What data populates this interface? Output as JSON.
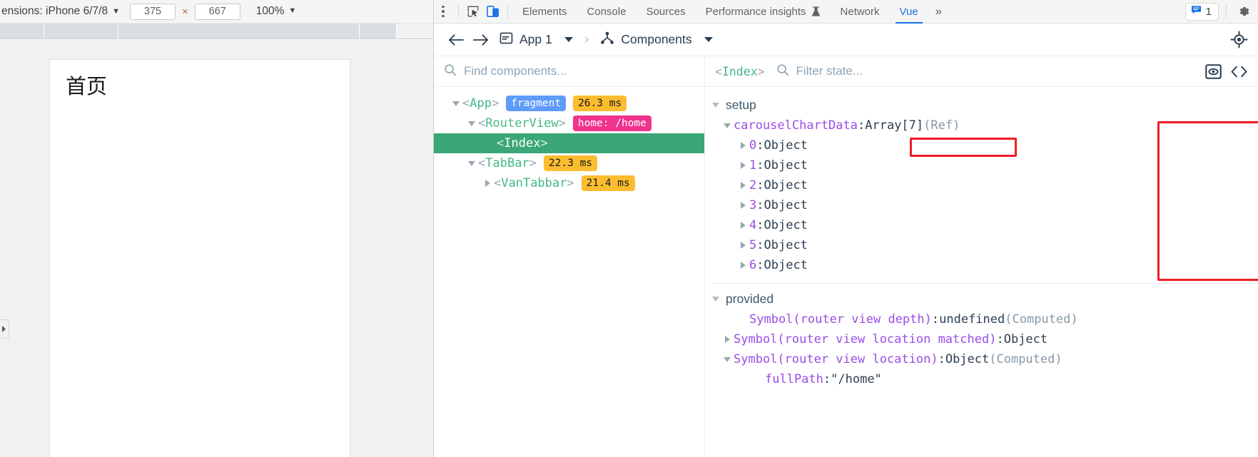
{
  "device_toolbar": {
    "dimensions_label": "ensions: iPhone 6/7/8",
    "width_value": "375",
    "x_symbol": "×",
    "height_value": "667",
    "zoom_value": "100%",
    "caret": "▼",
    "menu_icon": "kebab-menu-icon"
  },
  "viewport": {
    "page_heading": "首页"
  },
  "devtools": {
    "icons": {
      "inspect": "inspect-element-icon",
      "device": "device-toolbar-icon",
      "more_tabs": "»",
      "settings": "gear-icon",
      "issues": "issues-message-icon"
    },
    "tabs": [
      {
        "label": "Elements",
        "active": false
      },
      {
        "label": "Console",
        "active": false
      },
      {
        "label": "Sources",
        "active": false
      },
      {
        "label": "Performance insights",
        "active": false,
        "suffix_icon": "flask-icon"
      },
      {
        "label": "Network",
        "active": false
      },
      {
        "label": "Vue",
        "active": true
      }
    ],
    "issues_count": "1"
  },
  "vue_devtools": {
    "header": {
      "back_icon": "arrow-left-icon",
      "forward_icon": "arrow-right-icon",
      "app_icon": "app-window-icon",
      "app_label": "App 1",
      "breadcrumb_sep": "›",
      "view_icon": "component-tree-icon",
      "view_label": "Components",
      "target_icon": "select-component-target-icon"
    },
    "tree_panel": {
      "search_placeholder": "Find components...",
      "search_value": "",
      "search_icon": "search-icon",
      "nodes": [
        {
          "indent": 0,
          "twisty": "down",
          "open_br": "<",
          "name": "App",
          "close_br": ">",
          "badges": [
            {
              "text": "fragment",
              "kind": "fragment"
            },
            {
              "text": "26.3 ms",
              "kind": "time"
            }
          ],
          "selected": false
        },
        {
          "indent": 1,
          "twisty": "down",
          "open_br": "<",
          "name": "RouterView",
          "close_br": ">",
          "badges": [
            {
              "text": "home: /home",
              "kind": "route"
            }
          ],
          "selected": false
        },
        {
          "indent": 2,
          "twisty": "none",
          "open_br": "<",
          "name": "Index",
          "close_br": ">",
          "badges": [],
          "selected": true
        },
        {
          "indent": 1,
          "twisty": "down",
          "open_br": "<",
          "name": "TabBar",
          "close_br": ">",
          "badges": [
            {
              "text": "22.3 ms",
              "kind": "time"
            }
          ],
          "selected": false
        },
        {
          "indent": 2,
          "twisty": "right",
          "open_br": "<",
          "name": "VanTabbar",
          "close_br": ">",
          "badges": [
            {
              "text": "21.4 ms",
              "kind": "time"
            }
          ],
          "selected": false
        }
      ]
    },
    "state_panel": {
      "selected_component": {
        "open_br": "<",
        "name": "Index",
        "close_br": ">"
      },
      "filter_placeholder": "Filter state...",
      "filter_value": "",
      "search_icon": "search-icon",
      "eye_icon": "eye-inspect-icon",
      "code_icon": "open-in-editor-code-icon",
      "sections": [
        {
          "title": "setup",
          "rows": [
            {
              "indent": 0,
              "twisty": "down",
              "key": "carouselChartData",
              "key_color": "purple",
              "sep": ": ",
              "value": "Array[7]",
              "value_color": "dark",
              "extra": " (Ref)",
              "extra_color": "gray"
            },
            {
              "indent": 1,
              "twisty": "right",
              "key": "0",
              "key_color": "idx",
              "sep": ": ",
              "value": "Object",
              "value_color": "dark",
              "extra": "",
              "extra_color": "gray"
            },
            {
              "indent": 1,
              "twisty": "right",
              "key": "1",
              "key_color": "idx",
              "sep": ": ",
              "value": "Object",
              "value_color": "dark",
              "extra": "",
              "extra_color": "gray"
            },
            {
              "indent": 1,
              "twisty": "right",
              "key": "2",
              "key_color": "idx",
              "sep": ": ",
              "value": "Object",
              "value_color": "dark",
              "extra": "",
              "extra_color": "gray"
            },
            {
              "indent": 1,
              "twisty": "right",
              "key": "3",
              "key_color": "idx",
              "sep": ": ",
              "value": "Object",
              "value_color": "dark",
              "extra": "",
              "extra_color": "gray"
            },
            {
              "indent": 1,
              "twisty": "right",
              "key": "4",
              "key_color": "idx",
              "sep": ": ",
              "value": "Object",
              "value_color": "dark",
              "extra": "",
              "extra_color": "gray"
            },
            {
              "indent": 1,
              "twisty": "right",
              "key": "5",
              "key_color": "idx",
              "sep": ": ",
              "value": "Object",
              "value_color": "dark",
              "extra": "",
              "extra_color": "gray"
            },
            {
              "indent": 1,
              "twisty": "right",
              "key": "6",
              "key_color": "idx",
              "sep": ": ",
              "value": "Object",
              "value_color": "dark",
              "extra": "",
              "extra_color": "gray"
            }
          ]
        },
        {
          "title": "provided",
          "rows": [
            {
              "indent": 1,
              "twisty": "none",
              "key": "Symbol(router view depth)",
              "key_color": "purple",
              "sep": ": ",
              "value": "undefined",
              "value_color": "dark",
              "extra": " (Computed)",
              "extra_color": "gray"
            },
            {
              "indent": 1,
              "twisty": "right",
              "key": "Symbol(router view location matched)",
              "key_color": "purple",
              "sep": ": ",
              "value": "Object",
              "value_color": "dark",
              "extra": "",
              "extra_color": "gray"
            },
            {
              "indent": 1,
              "twisty": "down",
              "key": "Symbol(router view location)",
              "key_color": "purple",
              "sep": ": ",
              "value": "Object",
              "value_color": "dark",
              "extra": " (Computed)",
              "extra_color": "gray"
            },
            {
              "indent": 2,
              "twisty": "none",
              "key": "fullPath",
              "key_color": "purple",
              "sep": ": ",
              "value": "\"/home\"",
              "value_color": "dark",
              "extra": "",
              "extra_color": "gray"
            }
          ]
        }
      ]
    }
  },
  "annotations": {
    "accent_red": "#ee1c25",
    "boxes": [
      {
        "target": "vue-tab-highlight"
      },
      {
        "target": "index-node-highlight"
      },
      {
        "target": "setup-state-highlight"
      }
    ]
  }
}
